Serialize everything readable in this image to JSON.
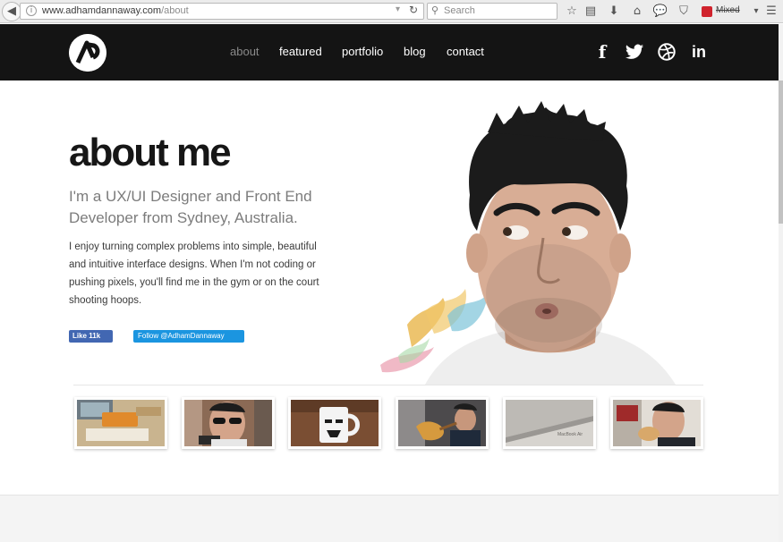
{
  "browser": {
    "back_glyph": "◀",
    "url_domain": "www.adhamdannaway.com",
    "url_path": "/about",
    "search_placeholder": "Search",
    "mixed_label": "Mixed",
    "icons": [
      "info-icon",
      "reload-icon",
      "search-icon",
      "bookmark-star-icon",
      "reading-list-icon",
      "download-icon",
      "home-icon",
      "chat-icon",
      "pocket-icon",
      "addon-icon",
      "menu-icon"
    ]
  },
  "header": {
    "nav": [
      {
        "label": "about",
        "active": true
      },
      {
        "label": "featured",
        "active": false
      },
      {
        "label": "portfolio",
        "active": false
      },
      {
        "label": "blog",
        "active": false
      },
      {
        "label": "contact",
        "active": false
      }
    ],
    "social": [
      {
        "icon": "facebook-icon",
        "glyph": "f"
      },
      {
        "icon": "twitter-icon",
        "glyph": "🐦"
      },
      {
        "icon": "dribbble-icon",
        "glyph": "◎"
      },
      {
        "icon": "linkedin-icon",
        "glyph": "in"
      }
    ]
  },
  "main": {
    "title": "about me",
    "subtitle": "I'm a UX/UI Designer and Front End Developer from Sydney, Australia.",
    "bio": "I enjoy turning complex problems into simple, beautiful and intuitive interface designs. When I'm not coding or pushing pixels, you'll find me in the gym or on the court shooting hoops.",
    "fb_like_label": "Like 11k",
    "twitter_follow_label": "Follow @AdhamDannaway"
  },
  "thumbnails": [
    {
      "name": "thumb-desk-setup"
    },
    {
      "name": "thumb-sunglasses"
    },
    {
      "name": "thumb-stormtrooper-mug"
    },
    {
      "name": "thumb-guitar"
    },
    {
      "name": "thumb-macbook"
    },
    {
      "name": "thumb-eating"
    }
  ],
  "colors": {
    "header_bg": "#141414",
    "nav_active": "#8a8a8a",
    "facebook": "#4267b2",
    "twitter": "#1b95e0"
  }
}
